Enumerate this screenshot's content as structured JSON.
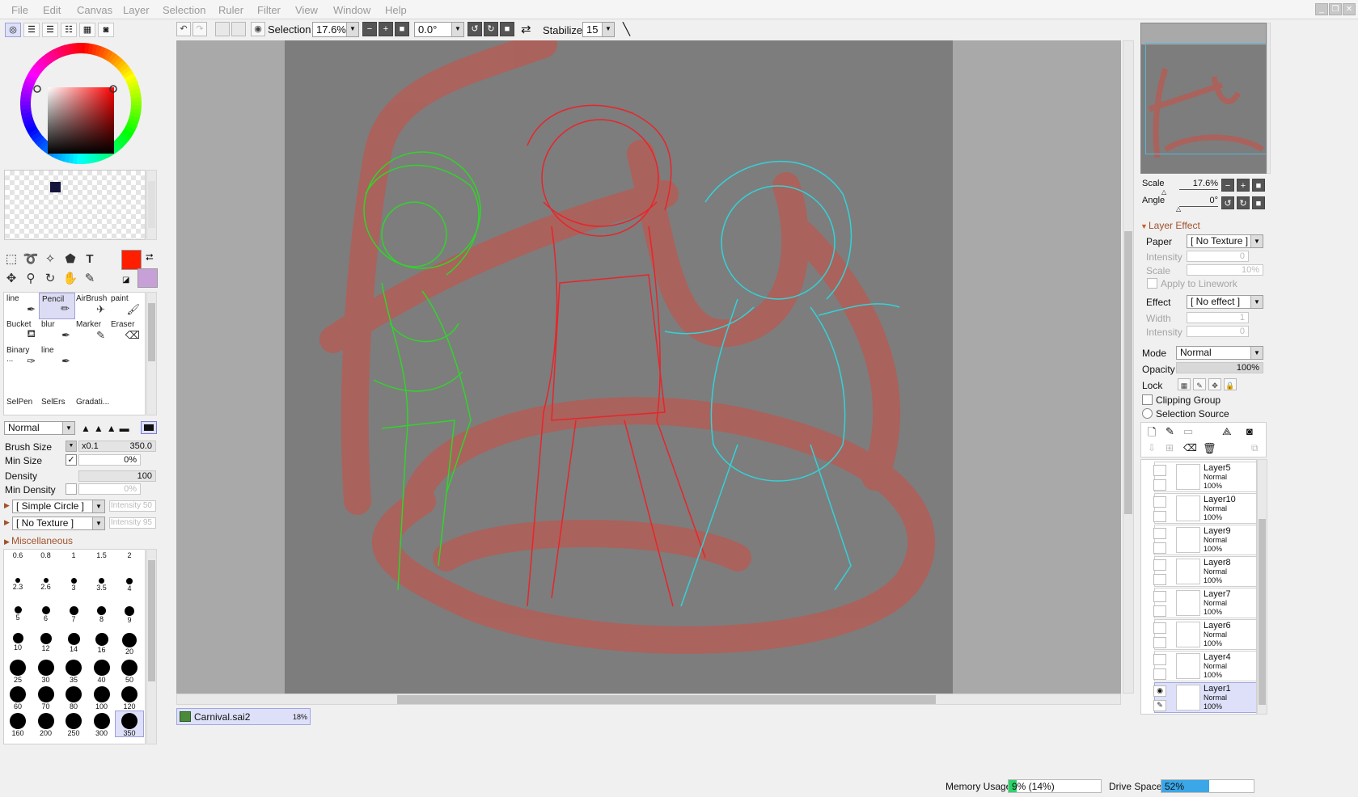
{
  "menu": [
    "File",
    "Edit",
    "Canvas",
    "Layer",
    "Selection",
    "Ruler",
    "Filter",
    "View",
    "Window",
    "Help"
  ],
  "window_buttons": [
    "_",
    "❐",
    "✕"
  ],
  "colors": {
    "foreground": "#ff1e00",
    "background": "#c8a0d8",
    "swatch_selected": "#14143c",
    "accent_orange": "#c0602e",
    "canvas_gray": "#7d7d7d",
    "sketch_red": "#e8252a",
    "sketch_green": "#31d42a",
    "sketch_cyan": "#33d2d8",
    "watermark_red": "#b35e57"
  },
  "toolbar": {
    "selection_label": "Selection",
    "zoom": "17.6%",
    "rotation": "0.0°",
    "stabilizer_label": "Stabilizer",
    "stabilizer_value": "15"
  },
  "brushes": [
    {
      "name": "line",
      "icon": "pen-icon"
    },
    {
      "name": "Pencil",
      "icon": "pencil-icon",
      "selected": true
    },
    {
      "name": "AirBrush",
      "icon": "airbrush-icon"
    },
    {
      "name": "paint",
      "icon": "brush-icon"
    },
    {
      "name": "Bucket",
      "icon": "bucket-icon"
    },
    {
      "name": "blur",
      "icon": "blur-icon"
    },
    {
      "name": "Marker",
      "icon": "marker-icon"
    },
    {
      "name": "Eraser",
      "icon": "eraser-icon"
    },
    {
      "name": "Binary ...",
      "icon": "binary-pen-icon"
    },
    {
      "name": "line",
      "icon": "pen-icon"
    }
  ],
  "brushes_bottom": [
    "SelPen",
    "SelErs",
    "Gradati..."
  ],
  "brush_settings": {
    "blend_mode": "Normal",
    "brush_size_label": "Brush Size",
    "brush_size_multiplier": "x0.1",
    "brush_size_value": "350.0",
    "min_size_label": "Min Size",
    "min_size_value": "0%",
    "density_label": "Density",
    "density_value": "100",
    "min_density_label": "Min Density",
    "min_density_value": "0%",
    "shape": "[ Simple Circle ]",
    "shape_intensity": "Intensity 50",
    "texture": "[ No Texture ]",
    "texture_intensity": "Intensity 95",
    "misc_label": "Miscellaneous"
  },
  "brush_sizes": [
    "0.6",
    "0.8",
    "1",
    "1.5",
    "2",
    "2.3",
    "2.6",
    "3",
    "3.5",
    "4",
    "5",
    "6",
    "7",
    "8",
    "9",
    "10",
    "12",
    "14",
    "16",
    "20",
    "25",
    "30",
    "35",
    "40",
    "50",
    "60",
    "70",
    "80",
    "100",
    "120",
    "160",
    "200",
    "250",
    "300",
    "350"
  ],
  "selected_brush_size": "350",
  "document_tab": {
    "name": "Carnival.sai2",
    "zoom": "18%"
  },
  "navigator": {
    "scale_label": "Scale",
    "scale_value": "17.6%",
    "angle_label": "Angle",
    "angle_value": "0°"
  },
  "layer_effect": {
    "title": "Layer Effect",
    "paper_label": "Paper",
    "paper_value": "[ No Texture ]",
    "intensity_label": "Intensity",
    "intensity_value": "0",
    "scale_label": "Scale",
    "scale_value": "10%",
    "apply_linework": "Apply to Linework",
    "effect_label": "Effect",
    "effect_value": "[ No effect ]",
    "width_label": "Width",
    "width_value": "1",
    "intensity2_label": "Intensity",
    "intensity2_value": "0"
  },
  "layer_props": {
    "mode_label": "Mode",
    "mode_value": "Normal",
    "opacity_label": "Opacity",
    "opacity_value": "100%",
    "lock_label": "Lock",
    "clipping_group": "Clipping Group",
    "selection_source": "Selection Source"
  },
  "layers": [
    {
      "name": "Layer5",
      "mode": "Normal",
      "opacity": "100%"
    },
    {
      "name": "Layer10",
      "mode": "Normal",
      "opacity": "100%"
    },
    {
      "name": "Layer9",
      "mode": "Normal",
      "opacity": "100%"
    },
    {
      "name": "Layer8",
      "mode": "Normal",
      "opacity": "100%"
    },
    {
      "name": "Layer7",
      "mode": "Normal",
      "opacity": "100%"
    },
    {
      "name": "Layer6",
      "mode": "Normal",
      "opacity": "100%"
    },
    {
      "name": "Layer4",
      "mode": "Normal",
      "opacity": "100%"
    },
    {
      "name": "Layer1",
      "mode": "Normal",
      "opacity": "100%",
      "selected": true
    }
  ],
  "status": {
    "memory_label": "Memory Usage",
    "memory_value": "9% (14%)",
    "memory_fraction": 0.09,
    "drive_label": "Drive Space",
    "drive_value": "52%",
    "drive_fraction": 0.52
  }
}
